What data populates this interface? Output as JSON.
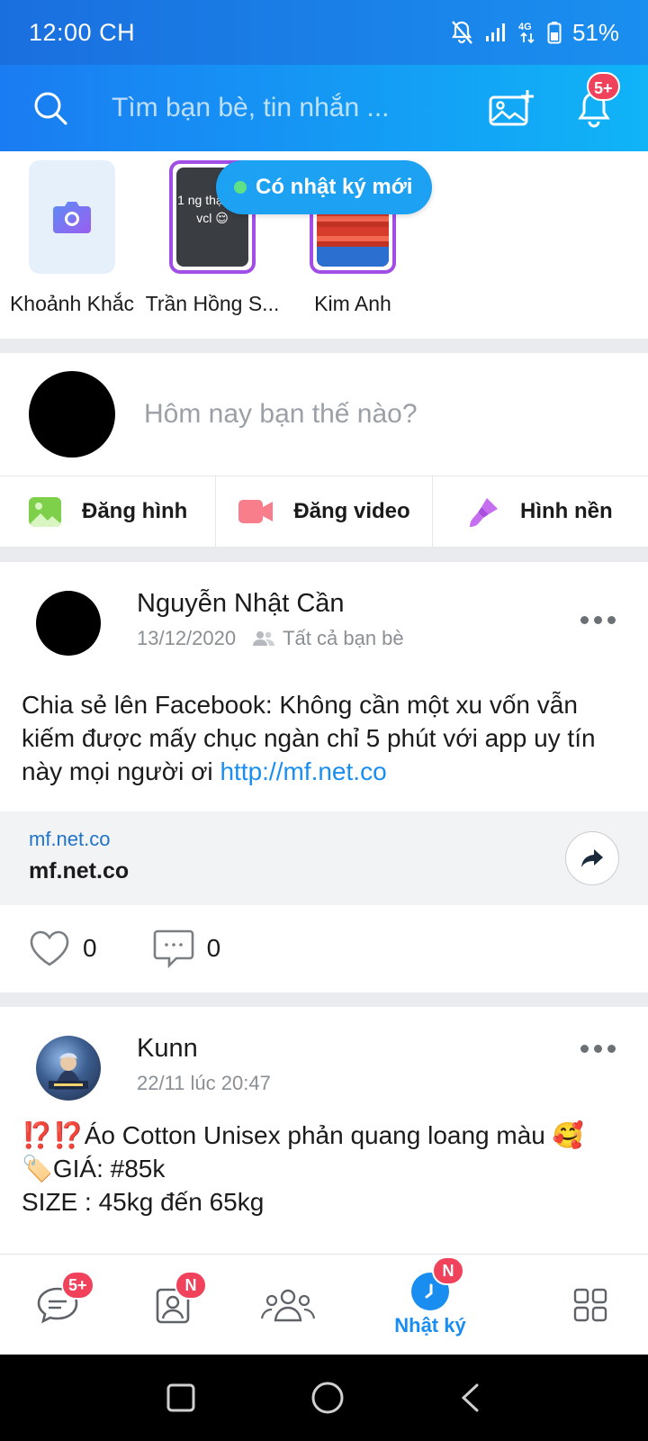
{
  "status_bar": {
    "time": "12:00 CH",
    "battery": "51%",
    "network": "4G"
  },
  "header": {
    "search_placeholder": "Tìm bạn bè, tin nhắn ...",
    "notification_badge": "5+"
  },
  "stories": {
    "new_diary_label": "Có nhật ký mới",
    "items": [
      {
        "name": "Khoảnh Khắc"
      },
      {
        "name": "Trần Hồng S...",
        "preview_text": "1 ng thậm tệ vcl 😌"
      },
      {
        "name": "Kim Anh"
      }
    ]
  },
  "composer": {
    "prompt": "Hôm nay bạn thế nào?",
    "actions": [
      {
        "label": "Đăng hình"
      },
      {
        "label": "Đăng video"
      },
      {
        "label": "Hình nền"
      }
    ]
  },
  "posts": [
    {
      "author": "Nguyễn Nhật Cần",
      "date": "13/12/2020",
      "audience": "Tất cả bạn bè",
      "text": "Chia sẻ lên Facebook: Không cần một xu vốn vẫn kiếm được mấy chục ngàn chỉ 5 phút với app uy tín này mọi người ơi ",
      "link": "http://mf.net.co",
      "preview_url": "mf.net.co",
      "preview_title": "mf.net.co",
      "likes": "0",
      "comments": "0"
    },
    {
      "author": "Kunn",
      "date": "22/11 lúc 20:47",
      "line1": "⁉️⁉️Áo Cotton Unisex phản quang loang màu 🥰",
      "line2": "🏷️GIÁ: #85k",
      "line3": "SIZE : 45kg đến 65kg"
    }
  ],
  "bottom_nav": {
    "messages_badge": "5+",
    "contacts_badge": "N",
    "diary_badge": "N",
    "diary_label": "Nhật ký"
  },
  "colors": {
    "accent": "#1a8ef0",
    "badge": "#f0425b",
    "story_ring": "#a14ee6"
  }
}
